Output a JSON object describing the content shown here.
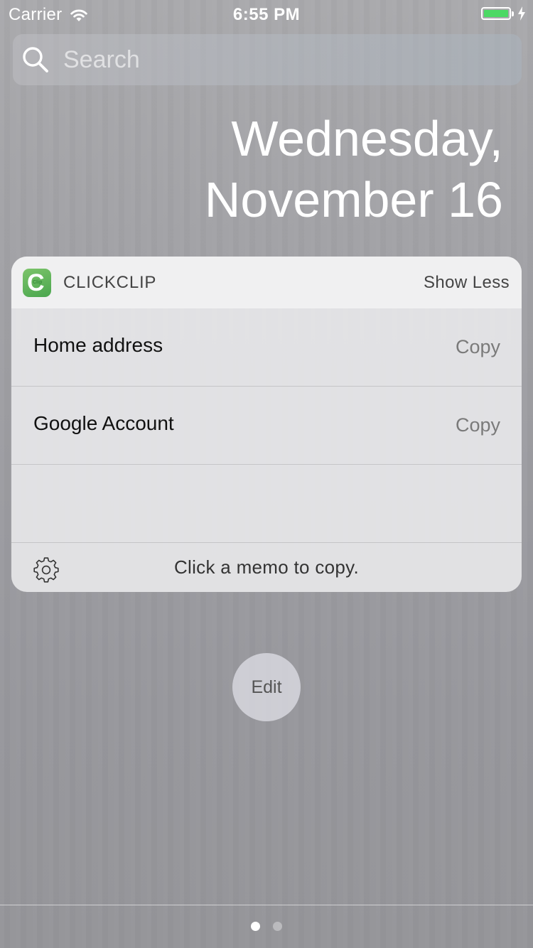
{
  "status_bar": {
    "carrier": "Carrier",
    "time": "6:55 PM",
    "battery_level": 1.0,
    "battery_color": "#4cd964",
    "charging": true
  },
  "search": {
    "placeholder": "Search"
  },
  "date": {
    "line1": "Wednesday,",
    "line2": "November 16"
  },
  "widget": {
    "app_name": "CLICKCLIP",
    "app_icon": {
      "letter": "C",
      "sub": "Clip",
      "color": "#5cb55a"
    },
    "toggle_label": "Show Less",
    "memos": [
      {
        "label": "Home address",
        "action": "Copy"
      },
      {
        "label": "Google Account",
        "action": "Copy"
      }
    ],
    "footer_text": "Click a memo to copy.",
    "footer_icon": "gear-icon"
  },
  "edit_label": "Edit",
  "page_indicator": {
    "count": 2,
    "current": 1
  }
}
